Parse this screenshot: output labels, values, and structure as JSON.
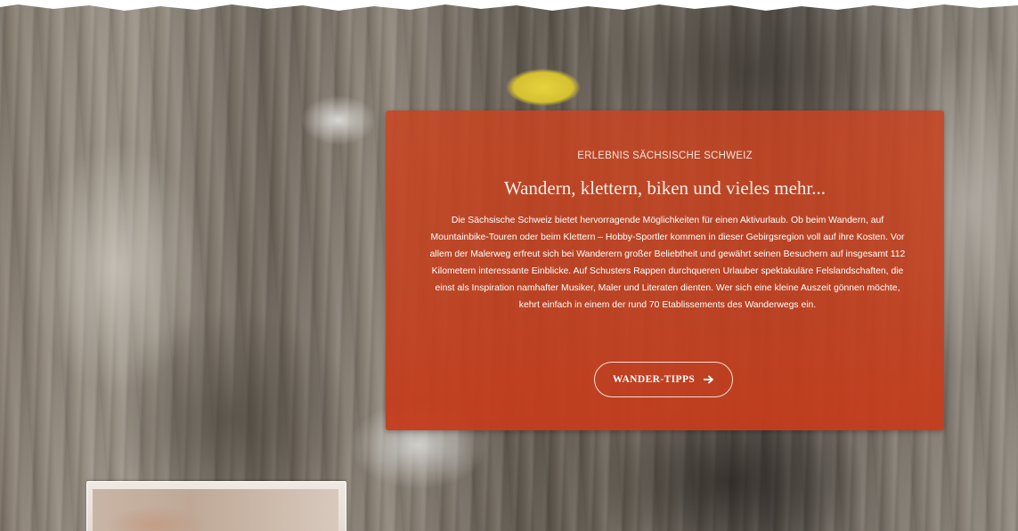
{
  "hero": {
    "eyebrow": "ERLEBNIS SÄCHSISCHE SCHWEIZ",
    "headline": "Wandern, klettern, biken und vieles mehr...",
    "body": "Die Sächsische Schweiz bietet hervorragende Möglichkeiten für einen Aktivurlaub. Ob beim Wandern, auf Mountainbike-Touren oder beim Klettern – Hobby-Sportler kommen in dieser Gebirgsregion voll auf ihre Kosten. Vor allem der Malerweg erfreut sich bei Wanderern großer Beliebtheit und gewährt seinen Besuchern auf insgesamt 112 Kilometern interessante Einblicke. Auf Schusters Rappen durchqueren Urlauber spektakuläre Felslandschaften, die einst als Inspiration namhafter Musiker, Maler und Literaten dienten. Wer sich eine kleine Auszeit gönnen möchte, kehrt einfach in einem der rund 70 Etablissements des Wanderwegs ein.",
    "cta_label": "WANDER-TIPPS",
    "cta_icon": "arrow-right-icon"
  },
  "colors": {
    "card": "#c8441f",
    "card_text": "#ffffff",
    "button_border": "#f5dcd0",
    "lichen": "#d6c130"
  }
}
